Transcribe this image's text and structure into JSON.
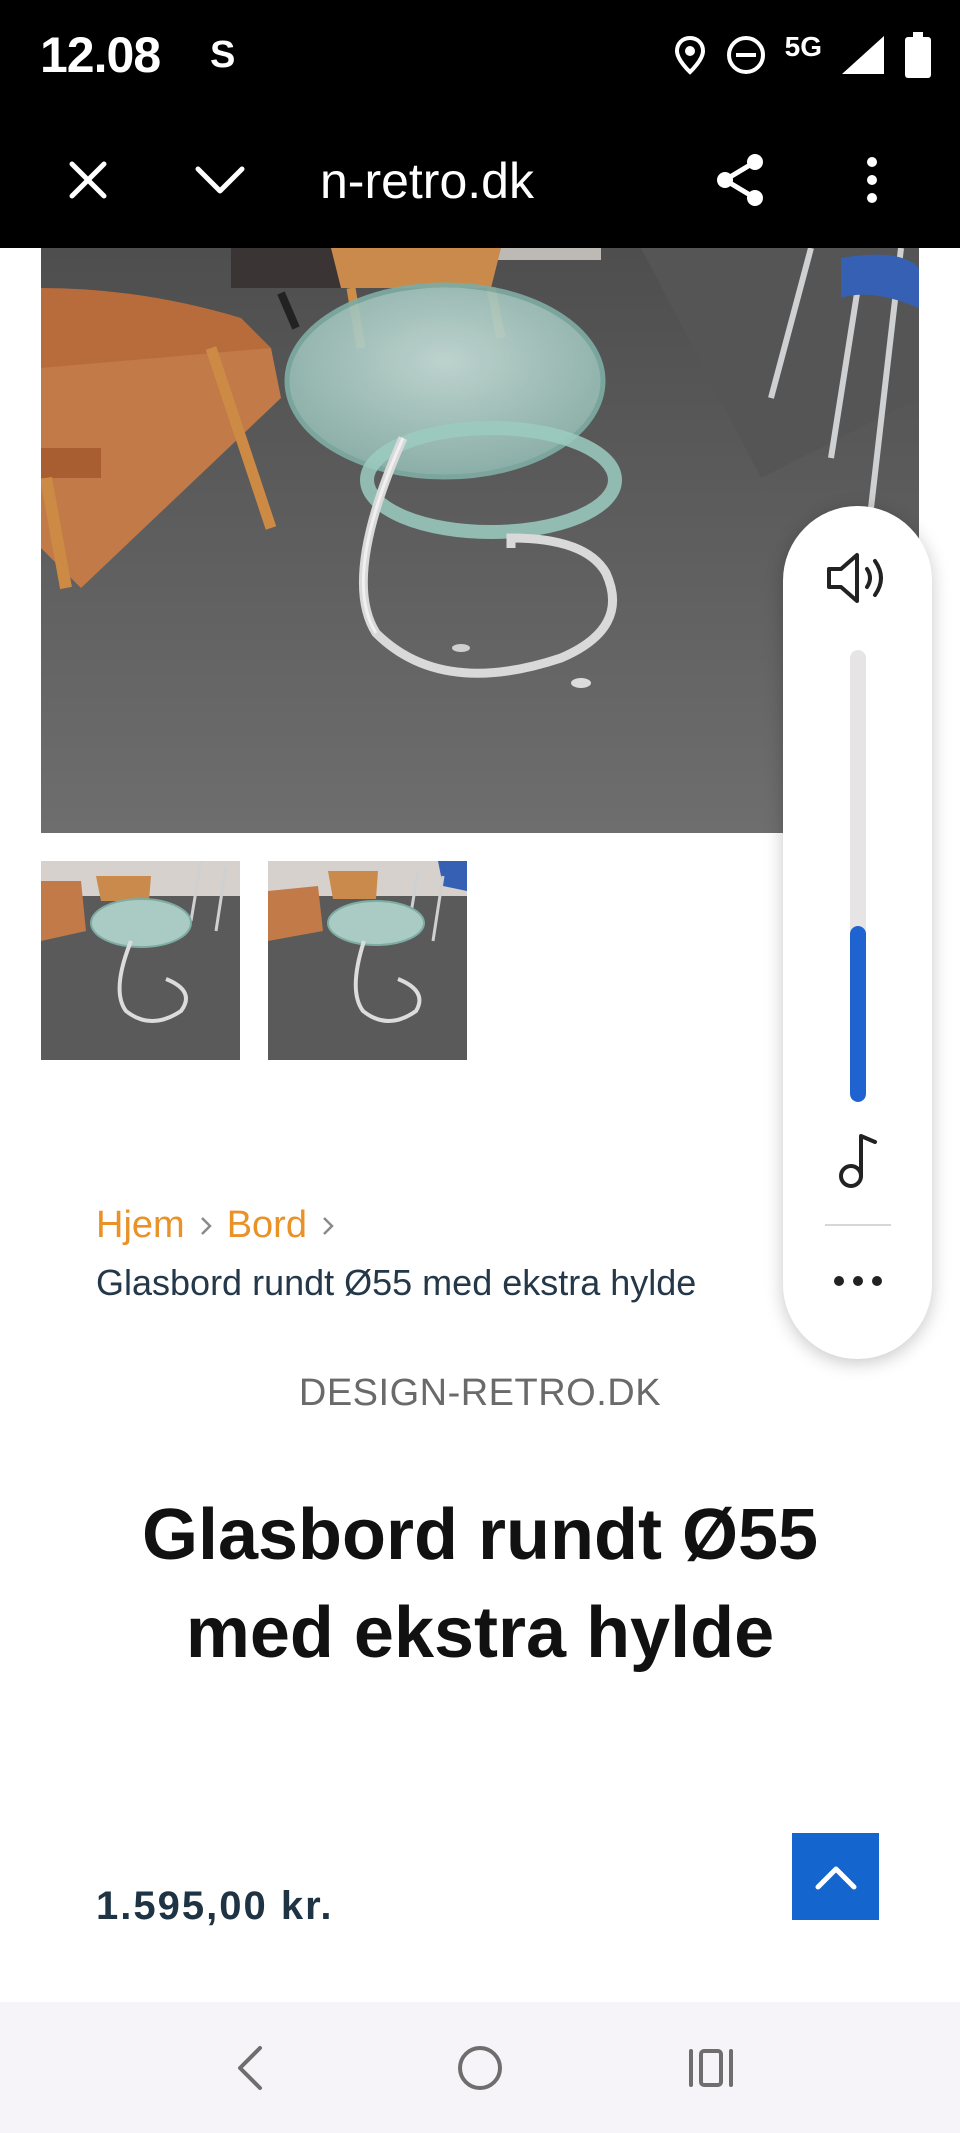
{
  "status_bar": {
    "time": "12.08",
    "carrier_letter": "S",
    "network": "5G",
    "icons": [
      "location-icon",
      "do-not-disturb-icon",
      "signal-icon",
      "battery-icon"
    ]
  },
  "toolbar": {
    "url": "n-retro.dk",
    "icons": [
      "close-icon",
      "chevron-down-icon",
      "share-icon",
      "more-vert-icon"
    ]
  },
  "breadcrumb": {
    "items": [
      {
        "label": "Hjem"
      },
      {
        "label": "Bord"
      }
    ],
    "current": "Glasbord rundt Ø55 med ekstra hylde"
  },
  "product": {
    "brand": "DESIGN-RETRO.DK",
    "title": "Glasbord rundt Ø55 med ekstra hylde",
    "price": "1.595,00 kr."
  },
  "volume_panel": {
    "level": 0.39,
    "icons": [
      "speaker-icon",
      "music-note-icon",
      "more-horiz-icon"
    ]
  },
  "nav_bar": {
    "icons": [
      "back-icon",
      "home-icon",
      "recents-icon"
    ]
  },
  "colors": {
    "breadcrumb_link": "#e89227",
    "accent_blue": "#1565cf",
    "volume_fill": "#1e63cf"
  }
}
